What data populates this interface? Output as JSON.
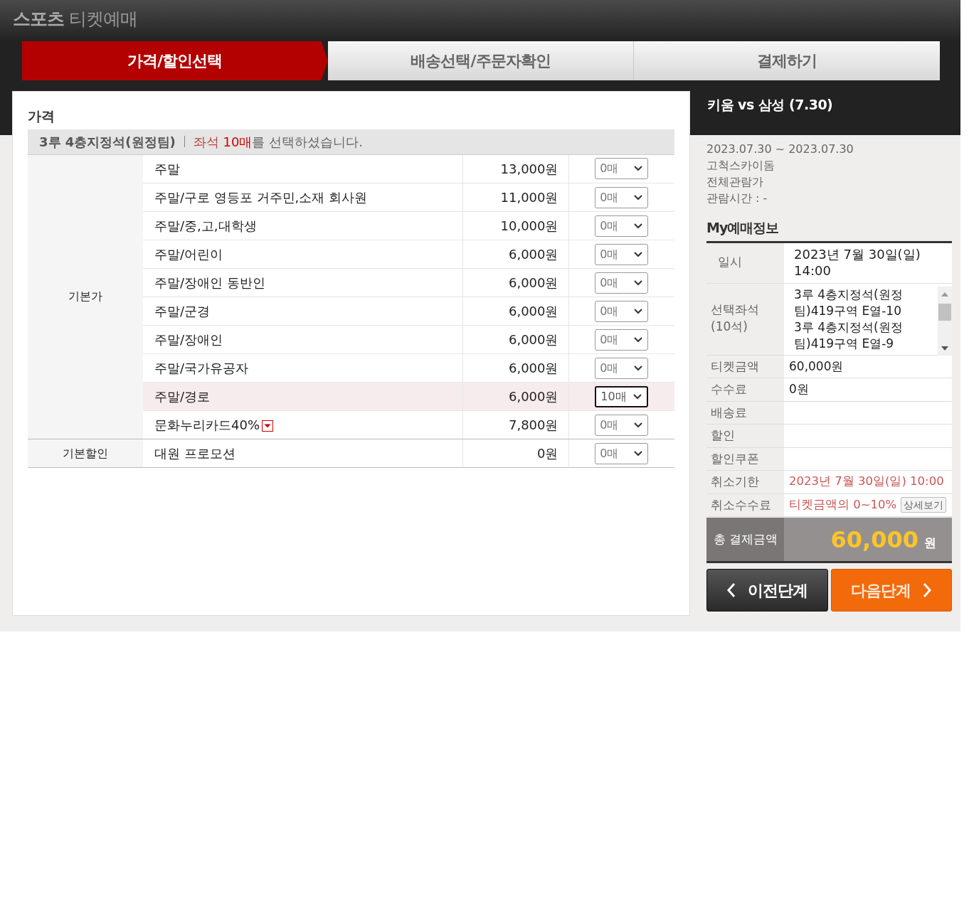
{
  "header": {
    "title": "**스포츠** 티켓예매"
  },
  "steps": [
    {
      "label": "가격/할인선택",
      "selected": true
    },
    {
      "label": "배송선택/주문자확인",
      "selected": false
    },
    {
      "label": "결제하기",
      "selected": false
    }
  ],
  "price": {
    "heading": "가격",
    "seat_grade": "3루 4층지정석(원정팀)",
    "seat_word": "좌석",
    "seat_count": "10매",
    "note": "를 선택하셨습니다.",
    "groups": [
      {
        "label": "기본가",
        "rows": [
          {
            "name": "주말",
            "price": "13,000원",
            "quantity": "0매",
            "selected": false,
            "dropdown_marker": false
          },
          {
            "name": "주말/구로 영등포 거주민,소재 회사원",
            "price": "11,000원",
            "quantity": "0매",
            "selected": false,
            "dropdown_marker": false
          },
          {
            "name": "주말/중,고,대학생",
            "price": "10,000원",
            "quantity": "0매",
            "selected": false,
            "dropdown_marker": false
          },
          {
            "name": "주말/어린이",
            "price": "6,000원",
            "quantity": "0매",
            "selected": false,
            "dropdown_marker": false
          },
          {
            "name": "주말/장애인 동반인",
            "price": "6,000원",
            "quantity": "0매",
            "selected": false,
            "dropdown_marker": false
          },
          {
            "name": "주말/군경",
            "price": "6,000원",
            "quantity": "0매",
            "selected": false,
            "dropdown_marker": false
          },
          {
            "name": "주말/장애인",
            "price": "6,000원",
            "quantity": "0매",
            "selected": false,
            "dropdown_marker": false
          },
          {
            "name": "주말/국가유공자",
            "price": "6,000원",
            "quantity": "0매",
            "selected": false,
            "dropdown_marker": false
          },
          {
            "name": "주말/경로",
            "price": "6,000원",
            "quantity": "10매",
            "selected": true,
            "dropdown_marker": false
          },
          {
            "name": "문화누리카드40%",
            "price": "7,800원",
            "quantity": "0매",
            "selected": false,
            "dropdown_marker": true
          }
        ]
      },
      {
        "label": "기본할인",
        "rows": [
          {
            "name": "대원 프로모션",
            "price": "0원",
            "quantity": "0매",
            "selected": false,
            "dropdown_marker": false
          }
        ]
      }
    ]
  },
  "summary": {
    "match_title": "키움 vs 삼성 (7.30)",
    "info": [
      "2023.07.30 ~ 2023.07.30",
      "고척스카이돔",
      "전체관람가",
      "관람시간 : -"
    ],
    "heading": "My예매정보",
    "rows": [
      {
        "kind": "plain",
        "label": "일시",
        "value": "2023년 7월 30일(일) 14:00"
      },
      {
        "kind": "seats",
        "label": "선택좌석",
        "sublabel": "(10석)",
        "seats": [
          "3루 4층지정석(원정팀)419구역 E열-10",
          "3루 4층지정석(원정팀)419구역 E열-9"
        ]
      },
      {
        "kind": "plain",
        "label": "티켓금액",
        "value": "60,000원"
      },
      {
        "kind": "plain",
        "label": "수수료",
        "value": "0원"
      },
      {
        "kind": "plain",
        "label": "배송료"
      },
      {
        "kind": "plain",
        "label": "할인"
      },
      {
        "kind": "plain",
        "label": "할인쿠폰"
      },
      {
        "kind": "alert",
        "label": "취소기한",
        "value": "2023년 7월 30일(일) 10:00"
      },
      {
        "kind": "alert",
        "label": "취소수수료",
        "value": "티켓금액의 0~10%",
        "button": "상세보기"
      }
    ],
    "total": {
      "label": "총 결제금액",
      "amount": "60,000",
      "unit": "원"
    },
    "buttons": [
      {
        "kind": "prev",
        "label": "이전단계"
      },
      {
        "kind": "next",
        "label": "다음단계"
      }
    ]
  }
}
